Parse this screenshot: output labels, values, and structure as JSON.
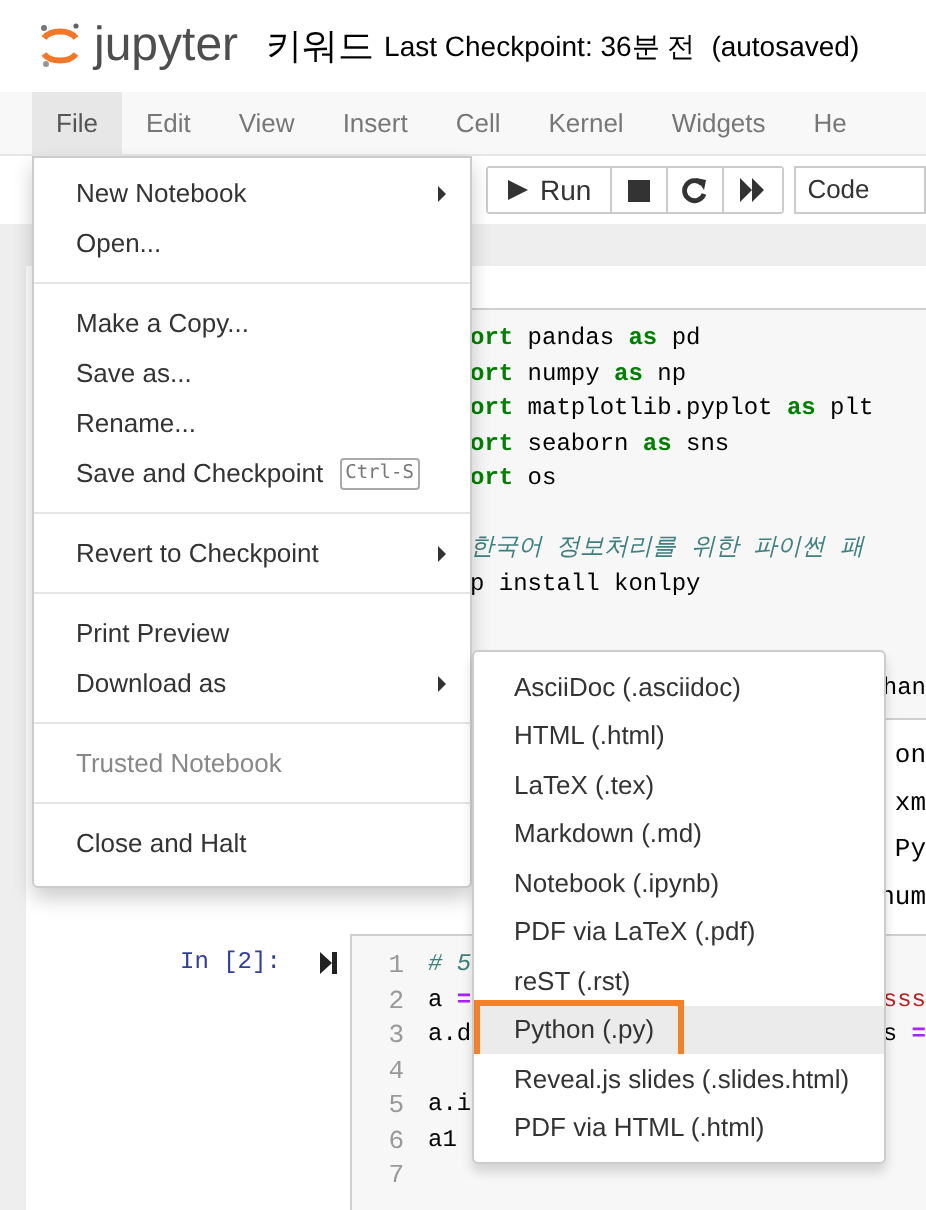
{
  "header": {
    "logo_text": "jupyter",
    "notebook_name": "키워드",
    "checkpoint": "Last Checkpoint: 36분 전",
    "autosave": "(autosaved)"
  },
  "menubar": [
    {
      "label": "File",
      "selected": true
    },
    {
      "label": "Edit",
      "selected": false
    },
    {
      "label": "View",
      "selected": false
    },
    {
      "label": "Insert",
      "selected": false
    },
    {
      "label": "Cell",
      "selected": false
    },
    {
      "label": "Kernel",
      "selected": false
    },
    {
      "label": "Widgets",
      "selected": false
    },
    {
      "label": "He",
      "selected": false
    }
  ],
  "toolbar": {
    "run_label": "Run",
    "cell_type": "Code"
  },
  "cells": [
    {
      "kind": "code",
      "lines": [
        {
          "kind": "code",
          "segments": [
            {
              "kind": "kw",
              "s": "ort"
            },
            {
              "kind": "plain",
              "s": " pandas "
            },
            {
              "kind": "kw",
              "s": "as"
            },
            {
              "kind": "plain",
              "s": " pd"
            }
          ]
        },
        {
          "kind": "code",
          "segments": [
            {
              "kind": "kw",
              "s": "ort"
            },
            {
              "kind": "plain",
              "s": " numpy "
            },
            {
              "kind": "kw",
              "s": "as"
            },
            {
              "kind": "plain",
              "s": " np"
            }
          ]
        },
        {
          "kind": "code",
          "segments": [
            {
              "kind": "kw",
              "s": "ort"
            },
            {
              "kind": "plain",
              "s": " matplotlib.pyplot "
            },
            {
              "kind": "kw",
              "s": "as"
            },
            {
              "kind": "plain",
              "s": " plt"
            }
          ]
        },
        {
          "kind": "code",
          "segments": [
            {
              "kind": "kw",
              "s": "ort"
            },
            {
              "kind": "plain",
              "s": " seaborn "
            },
            {
              "kind": "kw",
              "s": "as"
            },
            {
              "kind": "plain",
              "s": " sns"
            }
          ]
        },
        {
          "kind": "code",
          "segments": [
            {
              "kind": "kw",
              "s": "ort"
            },
            {
              "kind": "plain",
              "s": " os"
            }
          ]
        },
        {
          "kind": "blank"
        },
        {
          "kind": "code",
          "segments": [
            {
              "kind": "comment",
              "s": "한국어 정보처리를 위한 파이썬 패"
            }
          ]
        },
        {
          "kind": "code",
          "segments": [
            {
              "kind": "plain",
              "s": "p install konlpy"
            }
          ]
        }
      ],
      "right_fragment": "han"
    },
    {
      "kind": "output",
      "lines": [
        "on",
        "xm",
        "Py",
        "num"
      ]
    },
    {
      "kind": "numbered",
      "prompt": "In [2]:",
      "lines": [
        {
          "number": "1",
          "left": [
            {
              "kind": "comment",
              "s": "# 5"
            }
          ]
        },
        {
          "number": "2",
          "left": [
            {
              "kind": "plain",
              "s": "a "
            },
            {
              "kind": "op",
              "s": "="
            }
          ],
          "right": [
            {
              "kind": "string",
              "s": "sss"
            }
          ]
        },
        {
          "number": "3",
          "left": [
            {
              "kind": "plain",
              "s": "a.d"
            }
          ],
          "right": [
            {
              "kind": "plain",
              "s": "s "
            },
            {
              "kind": "op",
              "s": "="
            }
          ]
        },
        {
          "number": "4"
        },
        {
          "number": "5",
          "left": [
            {
              "kind": "plain",
              "s": "a.i"
            }
          ]
        },
        {
          "number": "6",
          "left": [
            {
              "kind": "plain",
              "s": "a1"
            }
          ]
        },
        {
          "number": "7"
        }
      ]
    }
  ],
  "file_menu": [
    {
      "kind": "item",
      "label": "New Notebook",
      "submenu": true,
      "disabled": false
    },
    {
      "kind": "item",
      "label": "Open...",
      "submenu": false,
      "disabled": false
    },
    {
      "kind": "divider"
    },
    {
      "kind": "item",
      "label": "Make a Copy...",
      "submenu": false,
      "disabled": false
    },
    {
      "kind": "item",
      "label": "Save as...",
      "submenu": false,
      "disabled": false
    },
    {
      "kind": "item",
      "label": "Rename...",
      "submenu": false,
      "disabled": false
    },
    {
      "kind": "item",
      "label": "Save and Checkpoint",
      "shortcut": "Ctrl-S",
      "submenu": false,
      "disabled": false
    },
    {
      "kind": "divider"
    },
    {
      "kind": "item",
      "label": "Revert to Checkpoint",
      "submenu": true,
      "disabled": false
    },
    {
      "kind": "divider"
    },
    {
      "kind": "item",
      "label": "Print Preview",
      "submenu": false,
      "disabled": false
    },
    {
      "kind": "item",
      "label": "Download as",
      "submenu": true,
      "disabled": false
    },
    {
      "kind": "divider"
    },
    {
      "kind": "item",
      "label": "Trusted Notebook",
      "submenu": false,
      "disabled": true
    },
    {
      "kind": "divider"
    },
    {
      "kind": "item",
      "label": "Close and Halt",
      "submenu": false,
      "disabled": false
    }
  ],
  "download_submenu": [
    {
      "label": "AsciiDoc (.asciidoc)",
      "hovered": false,
      "outlined": false
    },
    {
      "label": "HTML (.html)",
      "hovered": false,
      "outlined": false
    },
    {
      "label": "LaTeX (.tex)",
      "hovered": false,
      "outlined": false
    },
    {
      "label": "Markdown (.md)",
      "hovered": false,
      "outlined": false
    },
    {
      "label": "Notebook (.ipynb)",
      "hovered": false,
      "outlined": false
    },
    {
      "label": "PDF via LaTeX (.pdf)",
      "hovered": false,
      "outlined": false
    },
    {
      "label": "reST (.rst)",
      "hovered": false,
      "outlined": false
    },
    {
      "label": "Python (.py)",
      "hovered": true,
      "outlined": true
    },
    {
      "label": "Reveal.js slides (.slides.html)",
      "hovered": false,
      "outlined": false
    },
    {
      "label": "PDF via HTML (.html)",
      "hovered": false,
      "outlined": false
    }
  ]
}
